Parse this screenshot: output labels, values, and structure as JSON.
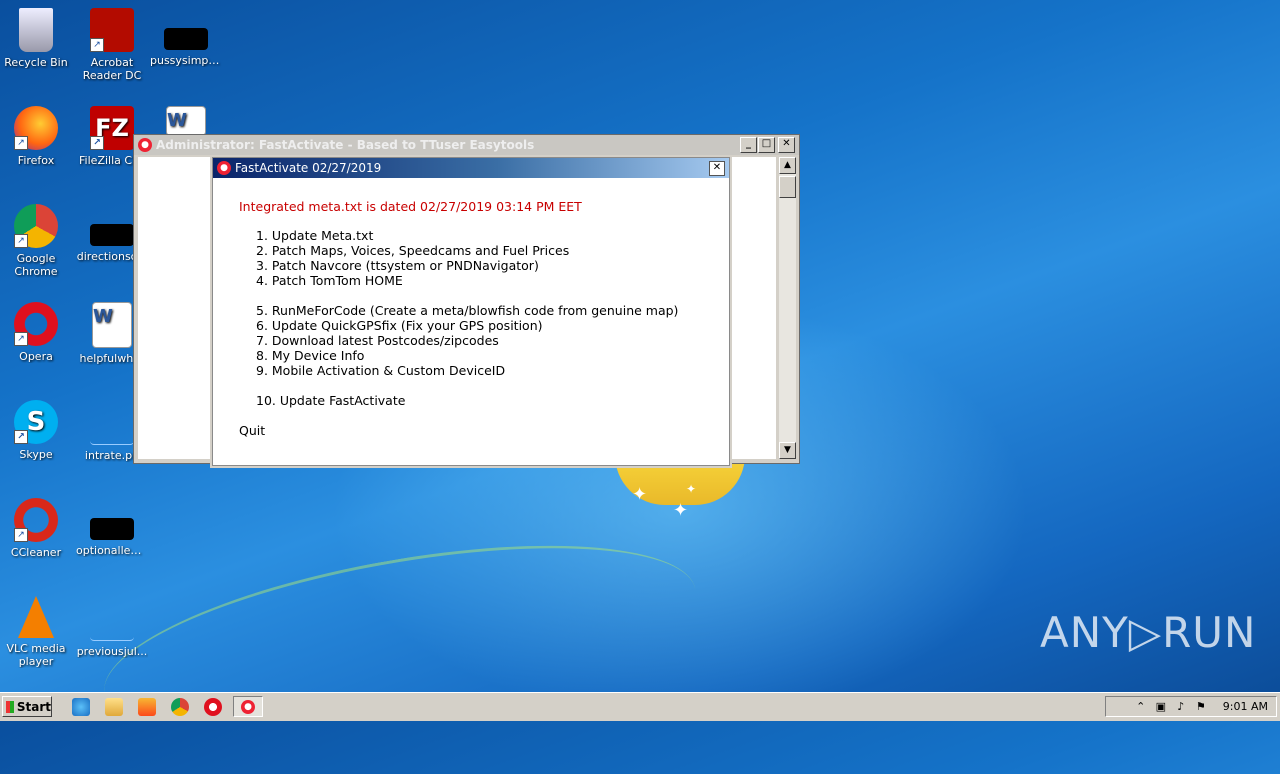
{
  "desktop": {
    "icons": [
      {
        "label": "Recycle Bin",
        "icon": "recycle-bin-icon"
      },
      {
        "label": "Acrobat Reader DC",
        "icon": "acrobat-icon"
      },
      {
        "label": "pussysimply...",
        "icon": "file-icon"
      },
      {
        "label": "Firefox",
        "icon": "firefox-icon"
      },
      {
        "label": "FileZilla Clie",
        "icon": "filezilla-icon"
      },
      {
        "label": "",
        "icon": "word-doc-icon"
      },
      {
        "label": "Google Chrome",
        "icon": "chrome-icon"
      },
      {
        "label": "directionsc...",
        "icon": "file-icon"
      },
      {
        "label": "Opera",
        "icon": "opera-icon"
      },
      {
        "label": "helpfulwher",
        "icon": "word-doc-icon"
      },
      {
        "label": "Skype",
        "icon": "skype-icon"
      },
      {
        "label": "intrate.pn",
        "icon": "image-file-icon"
      },
      {
        "label": "CCleaner",
        "icon": "ccleaner-icon"
      },
      {
        "label": "optionalleag...",
        "icon": "file-icon"
      },
      {
        "label": "VLC media player",
        "icon": "vlc-icon"
      },
      {
        "label": "previousjul...",
        "icon": "image-file-icon"
      }
    ]
  },
  "console": {
    "title": "Administrator:  FastActivate - Based to TTuser Easytools",
    "minimize": "_",
    "maximize": "□",
    "close": "✕"
  },
  "dialog": {
    "title": "FastActivate 02/27/2019",
    "close": "✕",
    "dated_line": "Integrated meta.txt is dated 02/27/2019 03:14 PM EET",
    "menu_group1": [
      "1. Update Meta.txt",
      "2. Patch Maps, Voices, Speedcams and Fuel Prices",
      "3. Patch Navcore (ttsystem or PNDNavigator)",
      "4. Patch TomTom HOME"
    ],
    "menu_group2": [
      "5. RunMeForCode (Create a meta/blowfish code from genuine map)",
      "6. Update QuickGPSfix (Fix your GPS position)",
      "7. Download latest Postcodes/zipcodes",
      "8. My Device Info",
      "9. Mobile Activation & Custom DeviceID"
    ],
    "menu_group3": [
      "10. Update FastActivate"
    ],
    "quit": "Quit"
  },
  "taskbar": {
    "start_label": "Start",
    "clock": "9:01 AM",
    "pinned": [
      "ie-icon",
      "explorer-icon",
      "media-player-icon",
      "chrome-icon",
      "opera-icon",
      "fastactivate-icon"
    ]
  },
  "watermark": "ANY▷RUN"
}
